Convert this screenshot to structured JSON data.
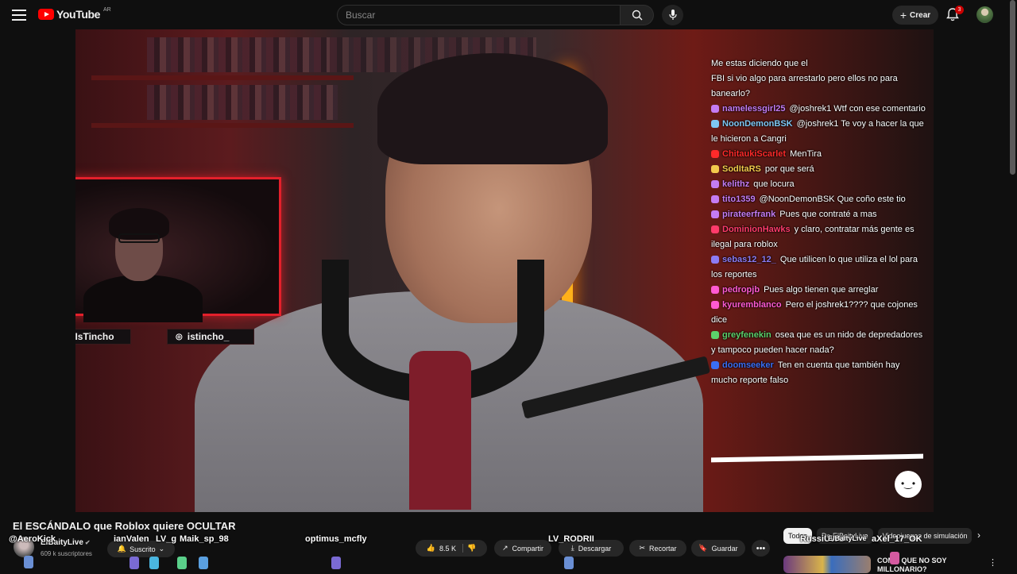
{
  "header": {
    "logo_text": "YouTube",
    "logo_country": "AR",
    "search_placeholder": "Buscar",
    "create_label": "Crear",
    "notifications_count": "3"
  },
  "video_overlay": {
    "social_twitter": "IsTincho",
    "social_instagram": "istincho_",
    "chat_messages": [
      {
        "name": "",
        "text": "Me estas diciendo que el",
        "color": "#ffffff"
      },
      {
        "name": "",
        "text": "FBI si vio algo para arrestarlo pero ellos no para banearlo?",
        "color": "#ffffff"
      },
      {
        "name": "namelessgirl25",
        "text": "@joshrek1 Wtf con ese comentario",
        "color": "#c47cf4"
      },
      {
        "name": "NoonDemonBSK",
        "text": "@joshrek1 Te voy a hacer la que le hicieron a Cangri",
        "color": "#7ec7f4"
      },
      {
        "name": "ChitaukiScarlet",
        "text": "MenTira",
        "color": "#ff2a2a"
      },
      {
        "name": "SodItaRS",
        "text": "por que será",
        "color": "#f2c94c"
      },
      {
        "name": "kelithz",
        "text": "que locura",
        "color": "#c47cf4"
      },
      {
        "name": "tito1359",
        "text": "@NoonDemonBSK Que coño este tio",
        "color": "#c47cf4"
      },
      {
        "name": "pirateerfrank",
        "text": "Pues que contraté a mas",
        "color": "#c47cf4"
      },
      {
        "name": "DominionHawks",
        "text": "y claro, contratar más gente es ilegal para roblox",
        "color": "#ff3b6b"
      },
      {
        "name": "sebas12_12_",
        "text": "Que utilicen lo que utiliza el lol para los reportes",
        "color": "#8c7cf4"
      },
      {
        "name": "pedropjb",
        "text": "Pues algo tienen que arreglar",
        "color": "#ff5ad2"
      },
      {
        "name": "kyuremblanco",
        "text": "Pero el joshrek1???? que cojones dice",
        "color": "#ff5ad2"
      },
      {
        "name": "greyfenekin",
        "text": "osea que es un nido de depredadores y tampoco pueden hacer nada?",
        "color": "#5cd16b"
      },
      {
        "name": "doomseeker",
        "text": "Ten en cuenta que también hay mucho reporte falso",
        "color": "#3a6ef4"
      }
    ],
    "bottom_names": [
      "@AeroKick",
      "ianValen",
      "LV_g",
      "Maik_sp_98",
      "optimus_mcfly",
      "LV_RODRII",
      "RussiUWU",
      "ElBaityLive",
      "aXel_17_OK"
    ]
  },
  "video_info": {
    "title": "El ESCÁNDALO que Roblox quiere OCULTAR",
    "channel_name": "ElBaityLive",
    "subscribers": "609 k suscriptores",
    "subscribed_label": "Suscrito",
    "likes": "8.5 K",
    "share_label": "Compartir",
    "download_label": "Descargar",
    "clip_label": "Recortar",
    "save_label": "Guardar"
  },
  "recommendations": {
    "chips": [
      "Todos",
      "De ElBaityLive",
      "Videojuegos de simulación"
    ],
    "item_title": "COMO QUE NO SOY MILLONARIO?"
  }
}
